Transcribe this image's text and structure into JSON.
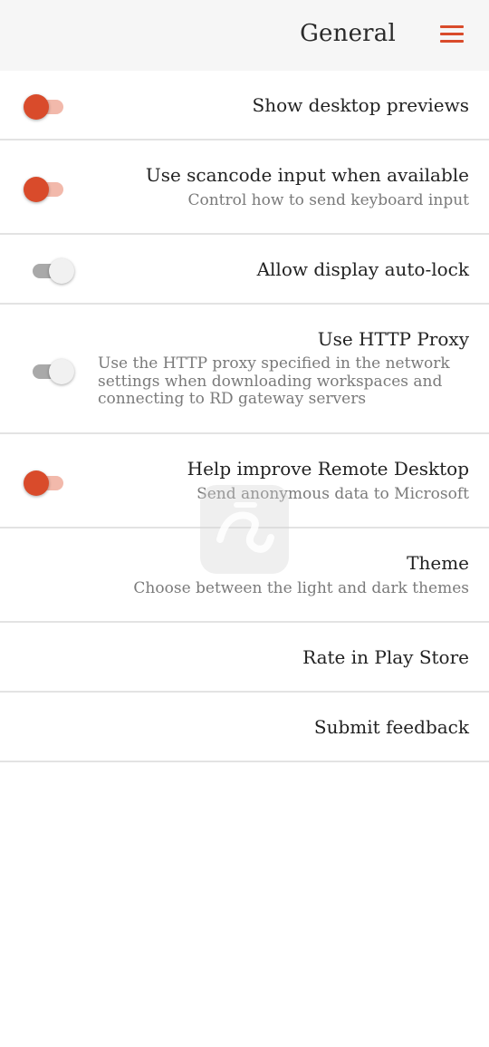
{
  "header": {
    "title": "General",
    "menu_icon": "hamburger-menu-icon",
    "accent_color": "#d94b2b"
  },
  "settings": [
    {
      "label": "Show desktop previews",
      "subtitle": "",
      "toggle": "on"
    },
    {
      "label": "Use scancode input when available",
      "subtitle": "Control how to send keyboard input",
      "toggle": "on"
    },
    {
      "label": "Allow display auto-lock",
      "subtitle": "",
      "toggle": "off"
    },
    {
      "label": "Use HTTP Proxy",
      "subtitle": "Use the HTTP proxy specified in the network settings when downloading workspaces and connecting to RD gateway servers",
      "toggle": "off"
    },
    {
      "label": "Help improve Remote Desktop",
      "subtitle": "Send anonymous data to Microsoft",
      "toggle": "on"
    },
    {
      "label": "Theme",
      "subtitle": "Choose between the light and dark themes",
      "toggle": null
    },
    {
      "label": "Rate in Play Store",
      "subtitle": "",
      "toggle": null
    },
    {
      "label": "Submit feedback",
      "subtitle": "",
      "toggle": null
    }
  ]
}
